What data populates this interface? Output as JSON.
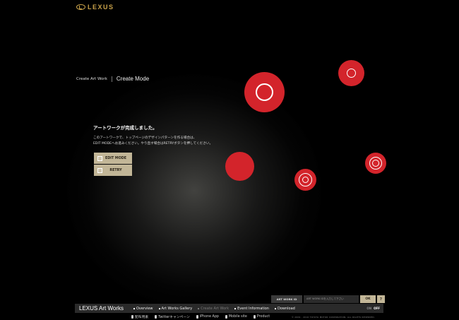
{
  "brand": {
    "logo_text": "LEXUS",
    "accent": "#c9a24a"
  },
  "breadcrumb": {
    "parent": "Create Art Work",
    "current": "Create Mode"
  },
  "message": {
    "title": "アートワークが完成しました。",
    "line1": "このアートワークで、トップページのデザインパターンを作る場合は、",
    "line2": "EDIT MODEへお進みください。やり直す場合はRETRYボタンを押してください。"
  },
  "buttons": {
    "edit": "EDIT MODE",
    "retry": "RETRY"
  },
  "artwork_bar": {
    "label": "ART WORK ID",
    "placeholder": "ART WORK IDを入力して下さい",
    "ok": "OK",
    "help": "?"
  },
  "nav": {
    "brand": "LEXUS Art Works",
    "items": [
      "Overview",
      "Art Works Gallery",
      "Create Art Work",
      "Event Information",
      "Download"
    ],
    "toggle_on": "ON",
    "toggle_off": "OFF"
  },
  "subnav": {
    "items": [
      "配布用素",
      "Twitterキャンペーン",
      "iPhone App",
      "Mobile site",
      "Product"
    ]
  },
  "copyright": "© 2009 - 2010 TOYOTA MOTOR CORPORATION. ALL RIGHTS RESERVED.",
  "colors": {
    "circle_red": "#d3242b",
    "button_beige": "#c2b697",
    "nav_bg": "#2a2a2a"
  }
}
